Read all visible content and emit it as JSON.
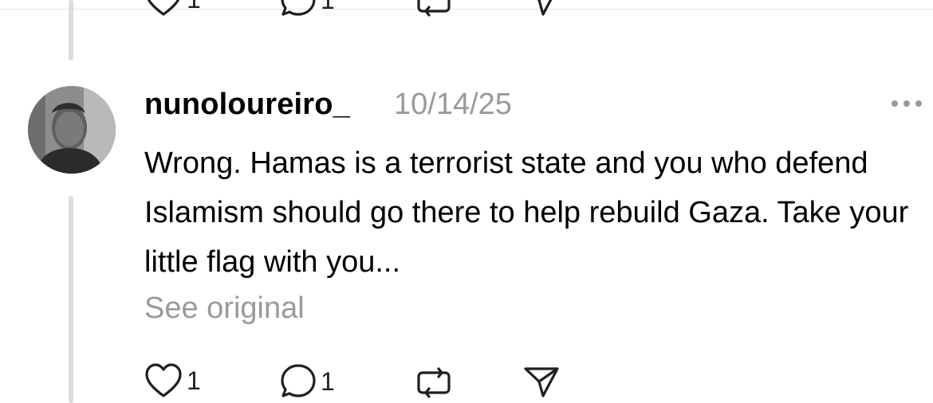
{
  "previous_post": {
    "like_count": "1",
    "reply_count": "1"
  },
  "reply": {
    "username": "nunoloureiro_",
    "timestamp": "10/14/25",
    "text": "Wrong. Hamas is a terrorist state and you who defend Islamism should go there to help rebuild Gaza. Take your little flag with you...",
    "see_original": "See original",
    "like_count": "1",
    "reply_count": "1"
  },
  "icons": {
    "like": "heart-icon",
    "reply": "speech-bubble-icon",
    "repost": "repost-icon",
    "share": "send-icon",
    "more": "more-icon"
  },
  "colors": {
    "muted_text": "#9a9a9a",
    "thread_line": "#dcdcdc"
  }
}
